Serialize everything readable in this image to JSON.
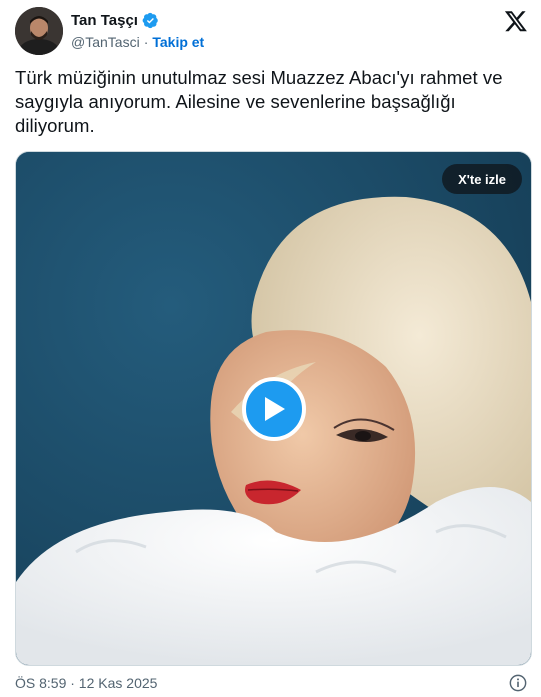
{
  "author": {
    "display_name": "Tan Taşçı",
    "handle": "@TanTasci",
    "separator": "·",
    "follow_label": "Takip et",
    "verified": true
  },
  "brand": {
    "logo_icon": "x-logo-icon"
  },
  "tweet": {
    "text": "Türk müziğinin unutulmaz sesi Muazzez Abacı'yı rahmet ve saygıyla anıyorum. Ailesine ve sevenlerine başsağlığı diliyorum."
  },
  "media": {
    "type": "video",
    "watch_label": "X'te izle",
    "play_icon": "play-icon"
  },
  "footer": {
    "timestamp": "ÖS 8:59 · 12 Kas 2025",
    "info_icon": "info-icon"
  },
  "colors": {
    "accent": "#1d9bf0",
    "follow_link": "#006fd6",
    "text_primary": "#0f1419",
    "text_secondary": "#536471",
    "photo_background": "#1d4d6a"
  }
}
